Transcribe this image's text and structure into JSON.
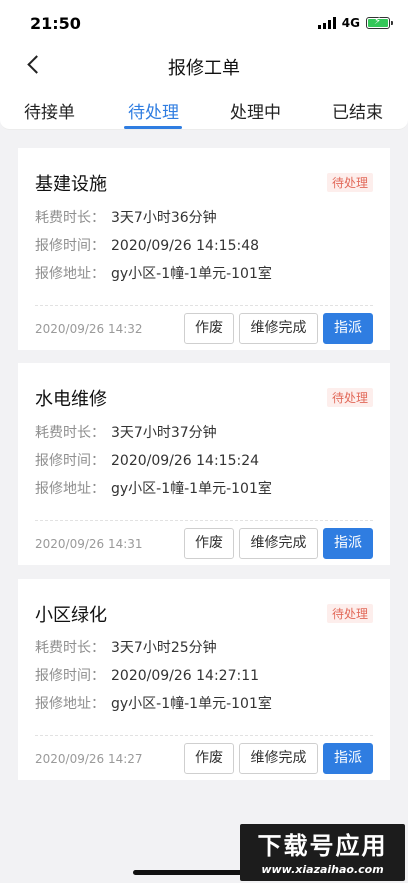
{
  "status_bar": {
    "time": "21:50",
    "network": "4G"
  },
  "nav": {
    "title": "报修工单"
  },
  "tabs": [
    {
      "label": "待接单",
      "active": false
    },
    {
      "label": "待处理",
      "active": true
    },
    {
      "label": "处理中",
      "active": false
    },
    {
      "label": "已结束",
      "active": false
    }
  ],
  "labels": {
    "duration": "耗费时长：",
    "report_time": "报修时间：",
    "address": "报修地址："
  },
  "cards": [
    {
      "title": "基建设施",
      "status": "待处理",
      "duration": "3天7小时36分钟",
      "report_time": "2020/09/26 14:15:48",
      "address": "gy小区-1幢-1单元-101室",
      "date": "2020/09/26 14:32",
      "void_label": "作废",
      "complete_label": "维修完成",
      "assign_label": "指派"
    },
    {
      "title": "水电维修",
      "status": "待处理",
      "duration": "3天7小时37分钟",
      "report_time": "2020/09/26 14:15:24",
      "address": "gy小区-1幢-1单元-101室",
      "date": "2020/09/26 14:31",
      "void_label": "作废",
      "complete_label": "维修完成",
      "assign_label": "指派"
    },
    {
      "title": "小区绿化",
      "status": "待处理",
      "duration": "3天7小时25分钟",
      "report_time": "2020/09/26 14:27:11",
      "address": "gy小区-1幢-1单元-101室",
      "date": "2020/09/26 14:27",
      "void_label": "作废",
      "complete_label": "维修完成",
      "assign_label": "指派"
    }
  ],
  "watermark": {
    "title": "下载号应用",
    "url": "www.xiazaihao.com"
  },
  "colors": {
    "accent": "#2f7de1",
    "badge_text": "#e26a5a",
    "badge_bg": "#fdeeec",
    "background": "#f2f2f4"
  }
}
